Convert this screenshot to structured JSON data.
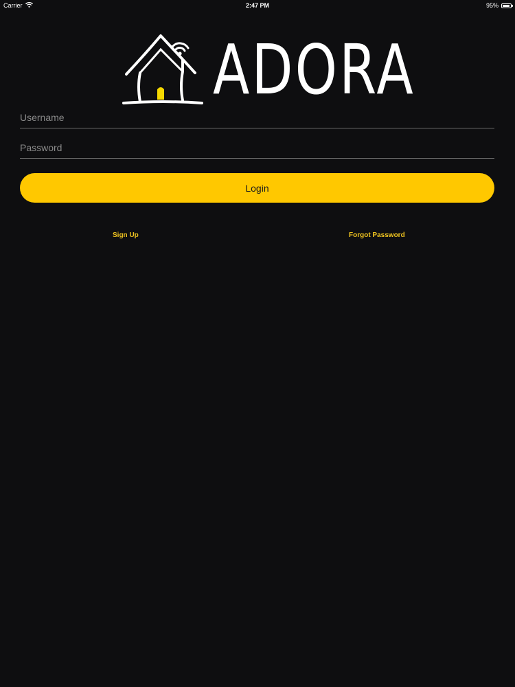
{
  "status_bar": {
    "carrier": "Carrier",
    "time": "2:47 PM",
    "battery_percent": "95%",
    "battery_level": 0.95
  },
  "logo": {
    "text": "ADORA"
  },
  "form": {
    "username_placeholder": "Username",
    "password_placeholder": "Password",
    "login_label": "Login"
  },
  "links": {
    "sign_up": "Sign Up",
    "forgot_password": "Forgot Password"
  },
  "colors": {
    "background": "#0e0e10",
    "accent": "#ffc800",
    "link": "#f0c420"
  }
}
